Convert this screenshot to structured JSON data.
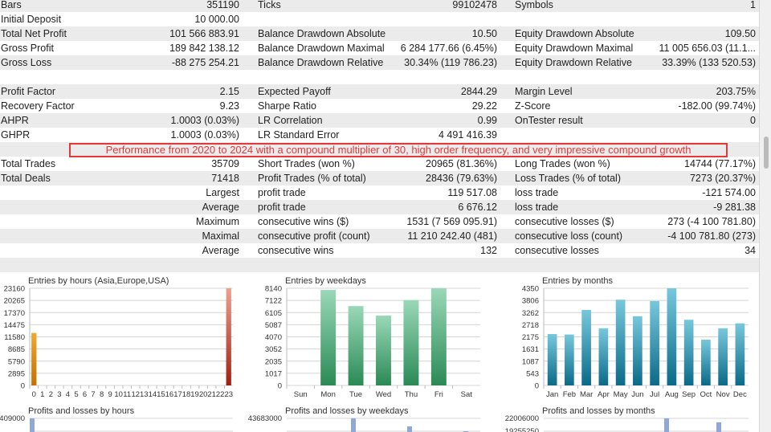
{
  "rows": [
    [
      "Bars",
      "351190",
      "Ticks",
      "99102478",
      "Symbols",
      "1"
    ],
    [
      "Initial Deposit",
      "10 000.00",
      "",
      "",
      "",
      ""
    ],
    [
      "Total Net Profit",
      "101 566 883.91",
      "Balance Drawdown Absolute",
      "10.50",
      "Equity Drawdown Absolute",
      "109.50"
    ],
    [
      "Gross Profit",
      "189 842 138.12",
      "Balance Drawdown Maximal",
      "6 284 177.66 (6.45%)",
      "Equity Drawdown Maximal",
      "11 005 656.03 (11.1..."
    ],
    [
      "Gross Loss",
      "-88 275 254.21",
      "Balance Drawdown Relative",
      "30.34% (119 786.23)",
      "Equity Drawdown Relative",
      "33.39% (133 520.53)"
    ],
    [
      "",
      "",
      "",
      "",
      "",
      ""
    ],
    [
      "Profit Factor",
      "2.15",
      "Expected Payoff",
      "2844.29",
      "Margin Level",
      "203.75%"
    ],
    [
      "Recovery Factor",
      "9.23",
      "Sharpe Ratio",
      "29.22",
      "Z-Score",
      "-182.00 (99.74%)"
    ],
    [
      "AHPR",
      "1.0003 (0.03%)",
      "LR Correlation",
      "0.99",
      "OnTester result",
      "0"
    ],
    [
      "GHPR",
      "1.0003 (0.03%)",
      "LR Standard Error",
      "4 491 416.39",
      "",
      ""
    ],
    null,
    [
      "Total Trades",
      "35709",
      "Short Trades (won %)",
      "20965 (81.36%)",
      "Long Trades (won %)",
      "14744 (77.17%)"
    ],
    [
      "Total Deals",
      "71418",
      "Profit Trades (% of total)",
      "28436 (79.63%)",
      "Loss Trades (% of total)",
      "7273 (20.37%)"
    ],
    [
      "",
      "Largest",
      "profit trade",
      "119 517.08",
      "loss trade",
      "-121 574.00"
    ],
    [
      "",
      "Average",
      "profit trade",
      "6 676.12",
      "loss trade",
      "-9 281.38"
    ],
    [
      "",
      "Maximum",
      "consecutive wins ($)",
      "1531 (7 569 095.91)",
      "consecutive losses ($)",
      "273 (-4 100 781.80)"
    ],
    [
      "",
      "Maximal",
      "consecutive profit (count)",
      "11 210 242.40 (481)",
      "consecutive loss (count)",
      "-4 100 781.80 (273)"
    ],
    [
      "",
      "Average",
      "consecutive wins",
      "132",
      "consecutive losses",
      "34"
    ],
    [
      "",
      "",
      "",
      "",
      "",
      ""
    ]
  ],
  "banner": "Performance from 2020 to 2024 with a compound multiplier of 30, high order frequency, and very impressive compound growth",
  "banner_color": "#e23a3a",
  "chart_data": [
    {
      "type": "bar",
      "title": "Entries by hours (Asia,Europe,USA)",
      "categories": [
        "0",
        "1",
        "2",
        "3",
        "4",
        "5",
        "6",
        "7",
        "8",
        "9",
        "10",
        "11",
        "12",
        "13",
        "14",
        "15",
        "16",
        "17",
        "18",
        "19",
        "20",
        "21",
        "22",
        "23"
      ],
      "values": [
        12500,
        0,
        0,
        0,
        0,
        0,
        0,
        0,
        0,
        0,
        0,
        0,
        0,
        0,
        0,
        0,
        0,
        0,
        0,
        0,
        0,
        0,
        0,
        23160
      ],
      "yticks": [
        "0",
        "2895",
        "5790",
        "8685",
        "11580",
        "14475",
        "17370",
        "20265",
        "23160"
      ],
      "ylim": [
        0,
        23160
      ],
      "colors": [
        "#f0a830",
        "#c87000"
      ],
      "colors_last": [
        "#f0a090",
        "#a02010"
      ]
    },
    {
      "type": "bar",
      "title": "Entries by weekdays",
      "categories": [
        "Sun",
        "Mon",
        "Tue",
        "Wed",
        "Thu",
        "Fri",
        "Sat"
      ],
      "values": [
        0,
        8000,
        6650,
        5850,
        7150,
        8140,
        0
      ],
      "yticks": [
        "0",
        "1017",
        "2035",
        "3052",
        "4070",
        "5087",
        "6105",
        "7122",
        "8140"
      ],
      "ylim": [
        0,
        8140
      ],
      "colors": [
        "#9ad8b8",
        "#2a8a55"
      ]
    },
    {
      "type": "bar",
      "title": "Entries by months",
      "categories": [
        "Jan",
        "Feb",
        "Mar",
        "Apr",
        "May",
        "Jun",
        "Jul",
        "Aug",
        "Sep",
        "Oct",
        "Nov",
        "Dec"
      ],
      "values": [
        2300,
        2280,
        3380,
        2560,
        3840,
        3100,
        3780,
        4350,
        2940,
        2050,
        2560,
        2780
      ],
      "yticks": [
        "0",
        "543",
        "1087",
        "1631",
        "2175",
        "2718",
        "3262",
        "3806",
        "4350"
      ],
      "ylim": [
        0,
        4350
      ],
      "colors": [
        "#78c8dc",
        "#0a6a88"
      ]
    },
    {
      "type": "bar",
      "title": "Profits and losses by hours",
      "ytop": "409000"
    },
    {
      "type": "bar",
      "title": "Profits and losses by weekdays",
      "ytop": "43683000"
    },
    {
      "type": "bar",
      "title": "Profits and losses by months",
      "ytop": "22006000",
      "ysecond": "19255250"
    }
  ]
}
